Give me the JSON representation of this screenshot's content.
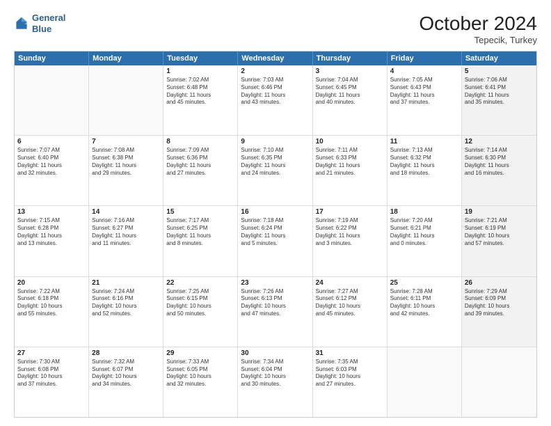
{
  "header": {
    "logo_line1": "General",
    "logo_line2": "Blue",
    "month": "October 2024",
    "location": "Tepecik, Turkey"
  },
  "weekdays": [
    "Sunday",
    "Monday",
    "Tuesday",
    "Wednesday",
    "Thursday",
    "Friday",
    "Saturday"
  ],
  "rows": [
    [
      {
        "day": "",
        "lines": [],
        "empty": true
      },
      {
        "day": "",
        "lines": [],
        "empty": true
      },
      {
        "day": "1",
        "lines": [
          "Sunrise: 7:02 AM",
          "Sunset: 6:48 PM",
          "Daylight: 11 hours",
          "and 45 minutes."
        ]
      },
      {
        "day": "2",
        "lines": [
          "Sunrise: 7:03 AM",
          "Sunset: 6:46 PM",
          "Daylight: 11 hours",
          "and 43 minutes."
        ]
      },
      {
        "day": "3",
        "lines": [
          "Sunrise: 7:04 AM",
          "Sunset: 6:45 PM",
          "Daylight: 11 hours",
          "and 40 minutes."
        ]
      },
      {
        "day": "4",
        "lines": [
          "Sunrise: 7:05 AM",
          "Sunset: 6:43 PM",
          "Daylight: 11 hours",
          "and 37 minutes."
        ]
      },
      {
        "day": "5",
        "lines": [
          "Sunrise: 7:06 AM",
          "Sunset: 6:41 PM",
          "Daylight: 11 hours",
          "and 35 minutes."
        ],
        "shaded": true
      }
    ],
    [
      {
        "day": "6",
        "lines": [
          "Sunrise: 7:07 AM",
          "Sunset: 6:40 PM",
          "Daylight: 11 hours",
          "and 32 minutes."
        ]
      },
      {
        "day": "7",
        "lines": [
          "Sunrise: 7:08 AM",
          "Sunset: 6:38 PM",
          "Daylight: 11 hours",
          "and 29 minutes."
        ]
      },
      {
        "day": "8",
        "lines": [
          "Sunrise: 7:09 AM",
          "Sunset: 6:36 PM",
          "Daylight: 11 hours",
          "and 27 minutes."
        ]
      },
      {
        "day": "9",
        "lines": [
          "Sunrise: 7:10 AM",
          "Sunset: 6:35 PM",
          "Daylight: 11 hours",
          "and 24 minutes."
        ]
      },
      {
        "day": "10",
        "lines": [
          "Sunrise: 7:11 AM",
          "Sunset: 6:33 PM",
          "Daylight: 11 hours",
          "and 21 minutes."
        ]
      },
      {
        "day": "11",
        "lines": [
          "Sunrise: 7:13 AM",
          "Sunset: 6:32 PM",
          "Daylight: 11 hours",
          "and 18 minutes."
        ]
      },
      {
        "day": "12",
        "lines": [
          "Sunrise: 7:14 AM",
          "Sunset: 6:30 PM",
          "Daylight: 11 hours",
          "and 16 minutes."
        ],
        "shaded": true
      }
    ],
    [
      {
        "day": "13",
        "lines": [
          "Sunrise: 7:15 AM",
          "Sunset: 6:28 PM",
          "Daylight: 11 hours",
          "and 13 minutes."
        ]
      },
      {
        "day": "14",
        "lines": [
          "Sunrise: 7:16 AM",
          "Sunset: 6:27 PM",
          "Daylight: 11 hours",
          "and 11 minutes."
        ]
      },
      {
        "day": "15",
        "lines": [
          "Sunrise: 7:17 AM",
          "Sunset: 6:25 PM",
          "Daylight: 11 hours",
          "and 8 minutes."
        ]
      },
      {
        "day": "16",
        "lines": [
          "Sunrise: 7:18 AM",
          "Sunset: 6:24 PM",
          "Daylight: 11 hours",
          "and 5 minutes."
        ]
      },
      {
        "day": "17",
        "lines": [
          "Sunrise: 7:19 AM",
          "Sunset: 6:22 PM",
          "Daylight: 11 hours",
          "and 3 minutes."
        ]
      },
      {
        "day": "18",
        "lines": [
          "Sunrise: 7:20 AM",
          "Sunset: 6:21 PM",
          "Daylight: 11 hours",
          "and 0 minutes."
        ]
      },
      {
        "day": "19",
        "lines": [
          "Sunrise: 7:21 AM",
          "Sunset: 6:19 PM",
          "Daylight: 10 hours",
          "and 57 minutes."
        ],
        "shaded": true
      }
    ],
    [
      {
        "day": "20",
        "lines": [
          "Sunrise: 7:22 AM",
          "Sunset: 6:18 PM",
          "Daylight: 10 hours",
          "and 55 minutes."
        ]
      },
      {
        "day": "21",
        "lines": [
          "Sunrise: 7:24 AM",
          "Sunset: 6:16 PM",
          "Daylight: 10 hours",
          "and 52 minutes."
        ]
      },
      {
        "day": "22",
        "lines": [
          "Sunrise: 7:25 AM",
          "Sunset: 6:15 PM",
          "Daylight: 10 hours",
          "and 50 minutes."
        ]
      },
      {
        "day": "23",
        "lines": [
          "Sunrise: 7:26 AM",
          "Sunset: 6:13 PM",
          "Daylight: 10 hours",
          "and 47 minutes."
        ]
      },
      {
        "day": "24",
        "lines": [
          "Sunrise: 7:27 AM",
          "Sunset: 6:12 PM",
          "Daylight: 10 hours",
          "and 45 minutes."
        ]
      },
      {
        "day": "25",
        "lines": [
          "Sunrise: 7:28 AM",
          "Sunset: 6:11 PM",
          "Daylight: 10 hours",
          "and 42 minutes."
        ]
      },
      {
        "day": "26",
        "lines": [
          "Sunrise: 7:29 AM",
          "Sunset: 6:09 PM",
          "Daylight: 10 hours",
          "and 39 minutes."
        ],
        "shaded": true
      }
    ],
    [
      {
        "day": "27",
        "lines": [
          "Sunrise: 7:30 AM",
          "Sunset: 6:08 PM",
          "Daylight: 10 hours",
          "and 37 minutes."
        ]
      },
      {
        "day": "28",
        "lines": [
          "Sunrise: 7:32 AM",
          "Sunset: 6:07 PM",
          "Daylight: 10 hours",
          "and 34 minutes."
        ]
      },
      {
        "day": "29",
        "lines": [
          "Sunrise: 7:33 AM",
          "Sunset: 6:05 PM",
          "Daylight: 10 hours",
          "and 32 minutes."
        ]
      },
      {
        "day": "30",
        "lines": [
          "Sunrise: 7:34 AM",
          "Sunset: 6:04 PM",
          "Daylight: 10 hours",
          "and 30 minutes."
        ]
      },
      {
        "day": "31",
        "lines": [
          "Sunrise: 7:35 AM",
          "Sunset: 6:03 PM",
          "Daylight: 10 hours",
          "and 27 minutes."
        ]
      },
      {
        "day": "",
        "lines": [],
        "empty": true
      },
      {
        "day": "",
        "lines": [],
        "empty": true,
        "shaded": true
      }
    ]
  ]
}
